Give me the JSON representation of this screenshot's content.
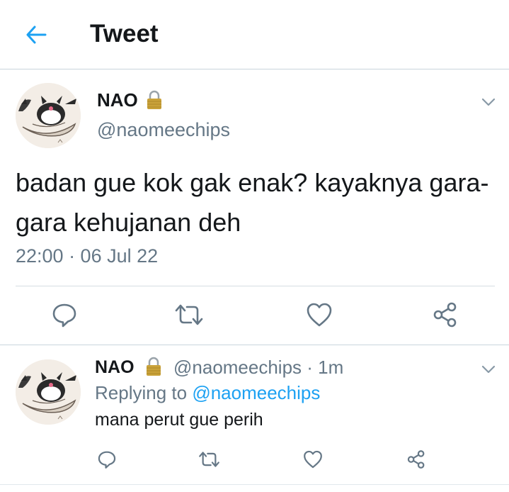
{
  "header": {
    "title": "Tweet"
  },
  "main_tweet": {
    "name": "NAO",
    "handle": "@naomeechips",
    "text": "badan gue kok gak enak? kayaknya gara-gara kehujanan deh",
    "timestamp": "22:00 · 06 Jul 22"
  },
  "reply": {
    "name": "NAO",
    "meta": "@naomeechips · 1m",
    "replying_prefix": "Replying to ",
    "replying_handle": "@naomeechips",
    "text": "mana perut gue perih"
  },
  "icons": [
    "back-arrow-icon",
    "lock-icon",
    "chevron-down-icon",
    "reply-icon",
    "retweet-icon",
    "like-icon",
    "share-icon"
  ],
  "colors": {
    "accent": "#1da1f2",
    "secondary_text": "#657786",
    "icon": "#657786"
  }
}
